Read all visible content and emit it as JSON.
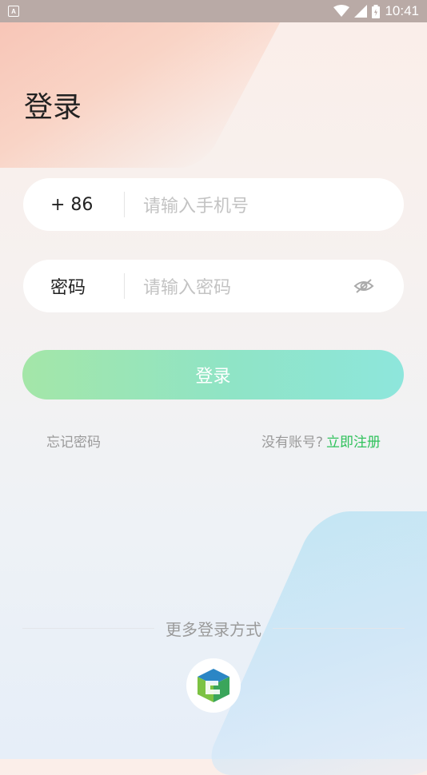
{
  "status_bar": {
    "app_badge": "A",
    "time": "10:41"
  },
  "page": {
    "title": "登录"
  },
  "phone_field": {
    "prefix": "+ 86",
    "placeholder": "请输入手机号"
  },
  "password_field": {
    "label": "密码",
    "placeholder": "请输入密码",
    "toggle_icon": "eye-off-icon"
  },
  "login_button": {
    "label": "登录"
  },
  "links": {
    "forgot_password": "忘记密码",
    "no_account": "没有账号?",
    "register": "立即注册"
  },
  "more_login": {
    "label": "更多登录方式",
    "provider_icon": "third-party-login-icon"
  },
  "colors": {
    "accent_green": "#2fc25b",
    "button_gradient_start": "#a4e6a8",
    "button_gradient_end": "#8ee6dc"
  }
}
